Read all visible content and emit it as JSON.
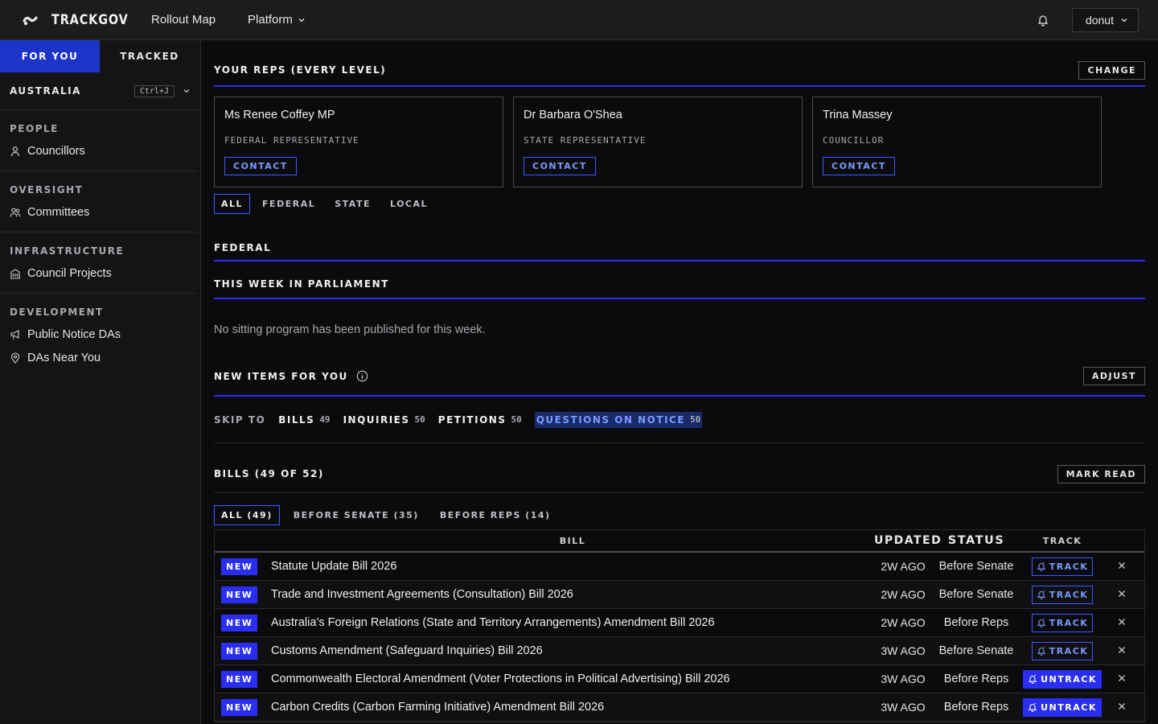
{
  "header": {
    "brand": "TRACKGOV",
    "nav": [
      {
        "label": "Rollout Map"
      },
      {
        "label": "Platform"
      }
    ],
    "user": "donut"
  },
  "sidebar": {
    "tabs": [
      {
        "label": "FOR YOU",
        "active": true
      },
      {
        "label": "TRACKED",
        "active": false
      }
    ],
    "region": {
      "name": "AUSTRALIA",
      "shortcut": "Ctrl+J"
    },
    "sections": [
      {
        "heading": "PEOPLE",
        "items": [
          {
            "label": "Councillors",
            "icon": "person-icon"
          }
        ]
      },
      {
        "heading": "OVERSIGHT",
        "items": [
          {
            "label": "Committees",
            "icon": "group-icon"
          }
        ]
      },
      {
        "heading": "INFRASTRUCTURE",
        "items": [
          {
            "label": "Council Projects",
            "icon": "building-icon"
          }
        ]
      },
      {
        "heading": "DEVELOPMENT",
        "items": [
          {
            "label": "Public Notice DAs",
            "icon": "megaphone-icon"
          },
          {
            "label": "DAs Near You",
            "icon": "map-pin-icon"
          }
        ]
      }
    ]
  },
  "reps": {
    "title": "YOUR REPS (EVERY LEVEL)",
    "change_label": "CHANGE",
    "cards": [
      {
        "name": "Ms Renee Coffey MP",
        "role": "FEDERAL REPRESENTATIVE",
        "action": "CONTACT"
      },
      {
        "name": "Dr Barbara O'Shea",
        "role": "STATE REPRESENTATIVE",
        "action": "CONTACT"
      },
      {
        "name": "Trina Massey",
        "role": "COUNCILLOR",
        "action": "CONTACT"
      }
    ],
    "filters": [
      "ALL",
      "FEDERAL",
      "STATE",
      "LOCAL"
    ]
  },
  "federal": {
    "title": "FEDERAL"
  },
  "week": {
    "title": "THIS WEEK IN PARLIAMENT",
    "empty": "No sitting program has been published for this week."
  },
  "new_items": {
    "title": "NEW ITEMS FOR YOU",
    "adjust_label": "ADJUST",
    "skip_label": "SKIP TO",
    "skip": [
      {
        "label": "BILLS",
        "count": "49"
      },
      {
        "label": "INQUIRIES",
        "count": "50"
      },
      {
        "label": "PETITIONS",
        "count": "50"
      },
      {
        "label": "QUESTIONS ON NOTICE",
        "count": "50"
      }
    ]
  },
  "bills": {
    "title": "BILLS (49 OF 52)",
    "mark_read": "MARK READ",
    "filters": [
      "ALL (49)",
      "BEFORE SENATE (35)",
      "BEFORE REPS (14)"
    ],
    "columns": {
      "bill": "BILL",
      "updated": "UPDATED",
      "status": "STATUS",
      "track": "TRACK"
    },
    "rows": [
      {
        "badge": "NEW",
        "title": "Statute Update Bill 2026",
        "updated": "2W AGO",
        "status": "Before Senate",
        "track": "TRACK",
        "tracked": false
      },
      {
        "badge": "NEW",
        "title": "Trade and Investment Agreements (Consultation) Bill 2026",
        "updated": "2W AGO",
        "status": "Before Senate",
        "track": "TRACK",
        "tracked": false
      },
      {
        "badge": "NEW",
        "title": "Australia’s Foreign Relations (State and Territory Arrangements) Amendment Bill 2026",
        "updated": "2W AGO",
        "status": "Before Reps",
        "track": "TRACK",
        "tracked": false
      },
      {
        "badge": "NEW",
        "title": "Customs Amendment (Safeguard Inquiries) Bill 2026",
        "updated": "3W AGO",
        "status": "Before Senate",
        "track": "TRACK",
        "tracked": false
      },
      {
        "badge": "NEW",
        "title": "Commonwealth Electoral Amendment (Voter Protections in Political Advertising) Bill 2026",
        "updated": "3W AGO",
        "status": "Before Reps",
        "track": "UNTRACK",
        "tracked": true
      },
      {
        "badge": "NEW",
        "title": "Carbon Credits (Carbon Farming Initiative) Amendment Bill 2026",
        "updated": "3W AGO",
        "status": "Before Reps",
        "track": "UNTRACK",
        "tracked": true
      }
    ]
  },
  "colors": {
    "accent": "#2a2ef0",
    "accent_text": "#7a9aff",
    "bg": "#0b0b0d"
  }
}
